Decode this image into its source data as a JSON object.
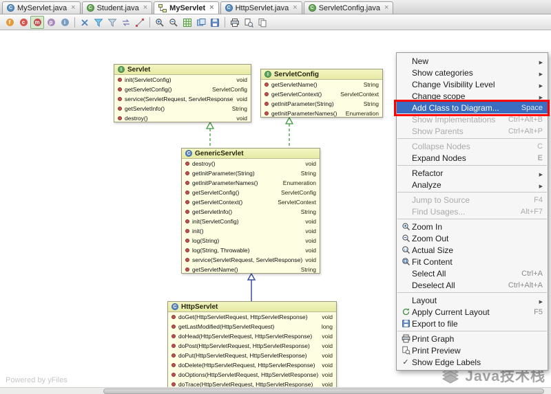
{
  "tabs": [
    {
      "label": "MyServlet.java",
      "icon": "class-icon"
    },
    {
      "label": "Student.java",
      "icon": "class-icon"
    },
    {
      "label": "MyServlet",
      "icon": "diagram-icon",
      "active": true
    },
    {
      "label": "HttpServlet.java",
      "icon": "class-icon"
    },
    {
      "label": "ServletConfig.java",
      "icon": "class-icon"
    }
  ],
  "toolbar": {
    "buttons": [
      "show-fields",
      "show-constructors",
      "show-methods",
      "show-properties",
      "show-inner-classes",
      "remove-from-diagram",
      "dependencies-filter",
      "edge-filter",
      "swap-direction",
      "draw-edges",
      "zoom-in",
      "zoom-out",
      "fit-content",
      "actual-size",
      "save-diagram",
      "print",
      "print-preview",
      "copy-diagram"
    ]
  },
  "diagram": {
    "nodes": [
      {
        "name": "Servlet",
        "kind": "interface",
        "methods": [
          {
            "sig": "init(ServletConfig)",
            "ret": "void"
          },
          {
            "sig": "getServletConfig()",
            "ret": "ServletConfig"
          },
          {
            "sig": "service(ServletRequest, ServletResponse)",
            "ret": "void"
          },
          {
            "sig": "getServletInfo()",
            "ret": "String"
          },
          {
            "sig": "destroy()",
            "ret": "void"
          }
        ]
      },
      {
        "name": "ServletConfig",
        "kind": "interface",
        "methods": [
          {
            "sig": "getServletName()",
            "ret": "String"
          },
          {
            "sig": "getServletContext()",
            "ret": "ServletContext"
          },
          {
            "sig": "getInitParameter(String)",
            "ret": "String"
          },
          {
            "sig": "getInitParameterNames()",
            "ret": "Enumeration"
          }
        ]
      },
      {
        "name": "GenericServlet",
        "kind": "class",
        "methods": [
          {
            "sig": "destroy()",
            "ret": "void"
          },
          {
            "sig": "getInitParameter(String)",
            "ret": "String"
          },
          {
            "sig": "getInitParameterNames()",
            "ret": "Enumeration"
          },
          {
            "sig": "getServletConfig()",
            "ret": "ServletConfig"
          },
          {
            "sig": "getServletContext()",
            "ret": "ServletContext"
          },
          {
            "sig": "getServletInfo()",
            "ret": "String"
          },
          {
            "sig": "init(ServletConfig)",
            "ret": "void"
          },
          {
            "sig": "init()",
            "ret": "void"
          },
          {
            "sig": "log(String)",
            "ret": "void"
          },
          {
            "sig": "log(String, Throwable)",
            "ret": "void"
          },
          {
            "sig": "service(ServletRequest, ServletResponse)",
            "ret": "void"
          },
          {
            "sig": "getServletName()",
            "ret": "String"
          }
        ]
      },
      {
        "name": "HttpServlet",
        "kind": "class",
        "methods": [
          {
            "sig": "doGet(HttpServletRequest, HttpServletResponse)",
            "ret": "void"
          },
          {
            "sig": "getLastModified(HttpServletRequest)",
            "ret": "long"
          },
          {
            "sig": "doHead(HttpServletRequest, HttpServletResponse)",
            "ret": "void"
          },
          {
            "sig": "doPost(HttpServletRequest, HttpServletResponse)",
            "ret": "void"
          },
          {
            "sig": "doPut(HttpServletRequest, HttpServletResponse)",
            "ret": "void"
          },
          {
            "sig": "doDelete(HttpServletRequest, HttpServletResponse)",
            "ret": "void"
          },
          {
            "sig": "doOptions(HttpServletRequest, HttpServletResponse)",
            "ret": "void"
          },
          {
            "sig": "doTrace(HttpServletRequest, HttpServletResponse)",
            "ret": "void"
          }
        ]
      }
    ],
    "edges": [
      {
        "from": "GenericServlet",
        "to": "Servlet",
        "type": "implements"
      },
      {
        "from": "GenericServlet",
        "to": "ServletConfig",
        "type": "implements"
      },
      {
        "from": "HttpServlet",
        "to": "GenericServlet",
        "type": "extends"
      }
    ]
  },
  "menu": {
    "items": [
      {
        "label": "New",
        "submenu": true
      },
      {
        "label": "Show categories",
        "submenu": true
      },
      {
        "label": "Change Visibility Level",
        "submenu": true
      },
      {
        "label": "Change scope",
        "submenu": true
      },
      {
        "label": "Add Class to Diagram...",
        "shortcut": "Space",
        "selected": true,
        "annotated": true
      },
      {
        "label": "Show Implementations",
        "shortcut": "Ctrl+Alt+B",
        "disabled": true
      },
      {
        "label": "Show Parents",
        "shortcut": "Ctrl+Alt+P",
        "disabled": true
      },
      {
        "label": "Collapse Nodes",
        "shortcut": "C",
        "disabled": true
      },
      {
        "label": "Expand Nodes",
        "shortcut": "E"
      },
      {
        "label": "Refactor",
        "submenu": true
      },
      {
        "label": "Analyze",
        "submenu": true
      },
      {
        "label": "Jump to Source",
        "shortcut": "F4",
        "disabled": true
      },
      {
        "label": "Find Usages...",
        "shortcut": "Alt+F7",
        "disabled": true
      },
      {
        "label": "Zoom In",
        "icon": "zoom-in-icon"
      },
      {
        "label": "Zoom Out",
        "icon": "zoom-out-icon"
      },
      {
        "label": "Actual Size",
        "icon": "actual-size-icon"
      },
      {
        "label": "Fit Content",
        "icon": "fit-content-icon"
      },
      {
        "label": "Select All",
        "shortcut": "Ctrl+A"
      },
      {
        "label": "Deselect All",
        "shortcut": "Ctrl+Alt+A"
      },
      {
        "label": "Layout",
        "submenu": true
      },
      {
        "label": "Apply Current Layout",
        "shortcut": "F5",
        "icon": "apply-layout-icon"
      },
      {
        "label": "Export to file",
        "icon": "export-icon"
      },
      {
        "label": "Print Graph",
        "icon": "print-icon"
      },
      {
        "label": "Print Preview",
        "icon": "print-preview-icon"
      },
      {
        "label": "Show Edge Labels",
        "checked": true
      }
    ]
  },
  "watermarks": {
    "yfiles": "Powered by yFiles",
    "brand": "Java技术栈"
  },
  "colors": {
    "menu_selection": "#3A6DBF",
    "annotation": "#FF0000",
    "node_fill": "#FDFEE2",
    "node_header_fill": "#EEF1B4",
    "implements_edge": "#3F9B3F",
    "extends_edge": "#3B4E9B"
  }
}
